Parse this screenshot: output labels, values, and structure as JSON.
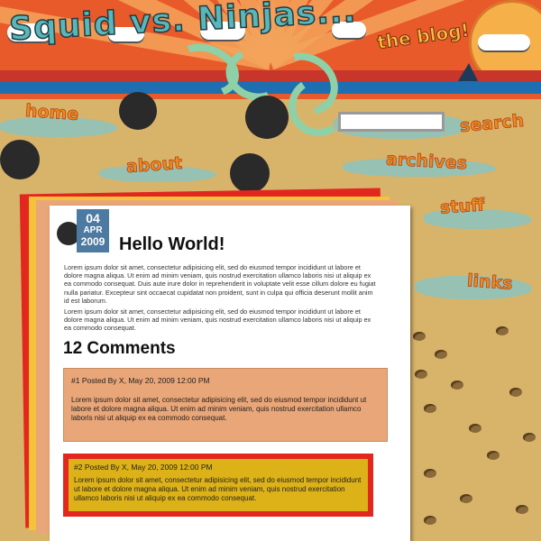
{
  "header": {
    "site_title": "Squid vs. Ninjas...",
    "tagline": "the blog!"
  },
  "nav": {
    "home": "home",
    "about": "about",
    "archives": "archives",
    "stuff": "stuff",
    "links": "links",
    "search": "search"
  },
  "search": {
    "value": ""
  },
  "post": {
    "date": {
      "day": "04",
      "month": "APR",
      "year": "2009"
    },
    "title": "Hello World!",
    "paragraph1": "Lorem ipsum dolor sit amet, consectetur adipisicing elit, sed do eiusmod tempor incididunt ut labore et dolore magna aliqua. Ut enim ad minim veniam, quis nostrud exercitation ullamco laboris nisi ut aliquip ex ea commodo consequat. Duis aute irure dolor in reprehenderit in voluptate velit esse cillum dolore eu fugiat nulla pariatur. Excepteur sint occaecat cupidatat non proident, sunt in culpa qui officia deserunt mollit anim id est laborum.",
    "paragraph2": "Lorem ipsum dolor sit amet, consectetur adipisicing elit, sed do eiusmod tempor incididunt ut labore et dolore magna aliqua. Ut enim ad minim veniam, quis nostrud exercitation ullamco laboris nisi ut aliquip ex ea commodo consequat."
  },
  "comments": {
    "heading": "12 Comments",
    "items": [
      {
        "meta": "#1 Posted By X, May 20, 2009 12:00 PM",
        "text": "Lorem ipsum dolor sit amet, consectetur adipisicing elit, sed do eiusmod tempor incididunt ut labore et dolore magna aliqua. Ut enim ad minim veniam, quis nostrud exercitation ullamco laboris nisi ut aliquip ex ea commodo consequat."
      },
      {
        "meta": "#2 Posted By X, May 20, 2009 12:00 PM",
        "text": "Lorem ipsum dolor sit amet, consectetur adipisicing elit, sed do eiusmod tempor incididunt ut labore et dolore magna aliqua. Ut enim ad minim veniam, quis nostrud exercitation ullamco laboris nisi ut aliquip ex ea commodo consequat."
      }
    ]
  },
  "colors": {
    "sand": "#d8b46a",
    "sky": "#e85a2a",
    "nav_orange": "#f08a1e",
    "title_teal": "#59b7b9",
    "sheet_red": "#e2271f",
    "sheet_orange": "#e9a678",
    "comment_yellow": "#ddb218"
  }
}
